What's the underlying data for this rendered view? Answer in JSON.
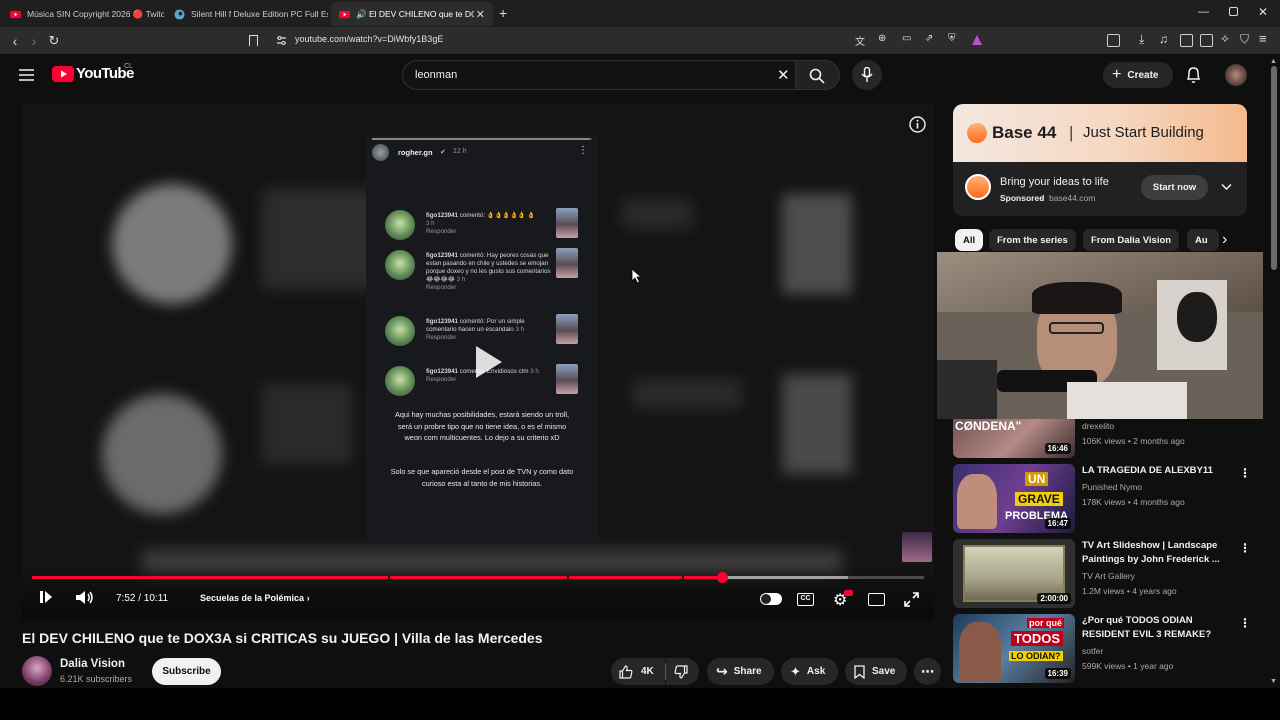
{
  "browser": {
    "tabs": [
      {
        "title": "Música SIN Copyright 2026 🔴 Twitc",
        "active": false
      },
      {
        "title": "Silent Hill f Deluxe Edition PC Full Esp",
        "active": false
      },
      {
        "title": "🔊 El DEV CHILENO que te DOX3A",
        "active": true
      }
    ],
    "url": "youtube.com/watch?v=DiWbfy1B3gE"
  },
  "youtube": {
    "logo": "YouTube",
    "region": "CL",
    "search_value": "leonman",
    "create_label": "Create"
  },
  "player": {
    "phone_user": "rogher.gn",
    "phone_time": "12 h",
    "comments": [
      {
        "user": "figo123941",
        "text": "comentó: 👌👌👌👌👌 👌",
        "time": "3 h",
        "reply": "Responder"
      },
      {
        "user": "figo123941",
        "text": "comentó: Hay peores cosas que estan pasando en chile y ustedes se emojan porque doxeo y no les gusto sus comentarios😂😂😂😂",
        "time": "3 h",
        "reply": "Responder"
      },
      {
        "user": "figo123941",
        "text": "comentó: Por un simple comentario hacen un escandalo",
        "time": "3 h",
        "reply": "Responder"
      },
      {
        "user": "figo123941",
        "text": "comentó: Envidiosos ctm",
        "time": "3 h",
        "reply": "Responder"
      }
    ],
    "caption_1": "Aqui hay muchas posibilidades, estará siendo un troll, será un probre tipo que no tiene idea, o es el mismo weon com multicuentes. Lo dejo a su criterio xD",
    "caption_2": "Solo se que apareció desde el post de TVN y como dato curioso esta al tanto de mis historias.",
    "time": "7:52 / 10:11",
    "chapter": "Secuelas de la Polémica",
    "progress": 0.773,
    "loaded": 0.915
  },
  "video": {
    "title": "El DEV CHILENO que te DOX3A si CRITICAS su JUEGO | Villa de las Mercedes",
    "channel": "Dalia Vision",
    "subscribers": "6.21K subscribers",
    "subscribe_label": "Subscribe",
    "likes": "4K",
    "share_label": "Share",
    "ask_label": "Ask",
    "save_label": "Save"
  },
  "ad": {
    "brand": "Base 44",
    "tagline": "Just Start Building",
    "headline": "Bring your ideas to life",
    "sponsored": "Sponsored",
    "domain": "base44.com",
    "cta": "Start now"
  },
  "chips": [
    "All",
    "From the series",
    "From Dalia Vision",
    "Au"
  ],
  "recommendations": [
    {
      "title": "CØNDENA\"",
      "channel": "drexelito",
      "meta": "106K views • 2 months ago",
      "duration": "16:46"
    },
    {
      "title": "LA TRAGEDIA DE ALEXBY11",
      "channel": "Punished Nymo",
      "meta": "178K views • 4 months ago",
      "duration": "16:47",
      "thumb_text_1": "UN",
      "thumb_text_2": "GRAVE",
      "thumb_text_3": "PROBLEMA"
    },
    {
      "title": "TV Art Slideshow | Landscape Paintings by John Frederick ...",
      "channel": "TV Art Gallery",
      "meta": "1.2M views • 4 years ago",
      "duration": "2:00:00"
    },
    {
      "title": "¿Por qué TODOS ODIAN RESIDENT EVIL 3 REMAKE?",
      "channel": "sotfer",
      "meta": "599K views • 1 year ago",
      "duration": "16:39",
      "thumb_text_1": "por qué",
      "thumb_text_2": "TODOS",
      "thumb_text_3": "LO ODIAN?"
    }
  ],
  "colors": {
    "accent_red": "#ff0033",
    "background": "#0f0f0f",
    "chip": "#272727"
  }
}
